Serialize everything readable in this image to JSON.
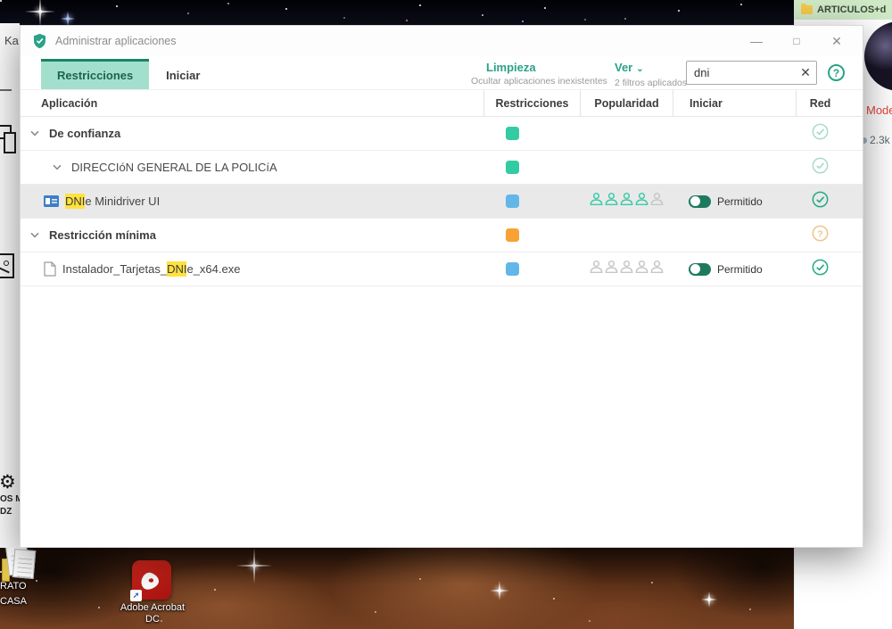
{
  "window": {
    "title": "Administrar aplicaciones",
    "controls": {
      "minimize": "—",
      "maximize": "□",
      "close": "✕"
    },
    "tabs": [
      {
        "label": "Restricciones",
        "active": true
      },
      {
        "label": "Iniciar",
        "active": false
      }
    ],
    "tools": {
      "limpieza_label": "Limpieza",
      "limpieza_sub": "Ocultar aplicaciones inexistentes",
      "ver_label": "Ver",
      "ver_chevron": "⌄",
      "ver_sub": "2 filtros aplicados",
      "search_value": "dni",
      "search_clear": "✕",
      "help_glyph": "?"
    },
    "columns": {
      "app": "Aplicación",
      "restrictions": "Restricciones",
      "popularity": "Popularidad",
      "start": "Iniciar",
      "network": "Red"
    },
    "rows": [
      {
        "kind": "group",
        "level": 0,
        "label": "De confianza",
        "restriction": "green",
        "red": "check_pale"
      },
      {
        "kind": "group",
        "level": 1,
        "label": "DIRECCIóN GENERAL DE LA POLICíA",
        "restriction": "green",
        "red": "check_pale"
      },
      {
        "kind": "app",
        "icon": "idcard",
        "name_pre": "",
        "name_hl": "DNI",
        "name_post": "e Minidriver UI",
        "restriction": "blue",
        "popularity": {
          "total": 5,
          "active": 4
        },
        "start_toggle": "Permitido",
        "red": "check_solid",
        "selected": true
      },
      {
        "kind": "group",
        "level": 0,
        "label": "Restricción mínima",
        "restriction": "orange",
        "red": "question"
      },
      {
        "kind": "app",
        "icon": "file",
        "name_pre": "Instalador_Tarjetas_",
        "name_hl": "DNI",
        "name_post": "e_x64.exe",
        "restriction": "blue",
        "popularity": {
          "total": 5,
          "active": 0
        },
        "start_toggle": "Permitido",
        "red": "check_solid",
        "selected": false
      }
    ]
  },
  "desktop": {
    "top_right_item": {
      "label": "ARTICULOS+d"
    },
    "right_panel": {
      "mode_label": "Mode",
      "stat_value": "2.3k"
    },
    "left_strip": {
      "title_fragment": "Ka",
      "gear_glyph": "⚙",
      "label1": "OS M",
      "label2": "DZ"
    },
    "icons": {
      "papers": {
        "label_line1": "RATO",
        "label_line2": "CASA"
      },
      "acrobat": {
        "label_line1": "Adobe Acrobat",
        "label_line2": "DC",
        "shortcut_glyph": "➚"
      }
    }
  },
  "colors": {
    "accent_green": "#2aa287",
    "tab_active_bg": "#a2e0cd",
    "tab_active_border": "#1a8466",
    "restriction_green": "#33cba3",
    "restriction_blue": "#62b7e8",
    "restriction_orange": "#f7a233",
    "toggle_on": "#1e7a5f",
    "person_active": "#3cc9a7",
    "person_inactive": "#c6c6c6",
    "check_solid": "#26ab84",
    "check_pale": "#a9dcc6",
    "question_pale": "#f0c48c",
    "highlight_yellow": "#ffe23e",
    "selected_row_bg": "#e9e9e9",
    "mode_red": "#e8443a"
  }
}
